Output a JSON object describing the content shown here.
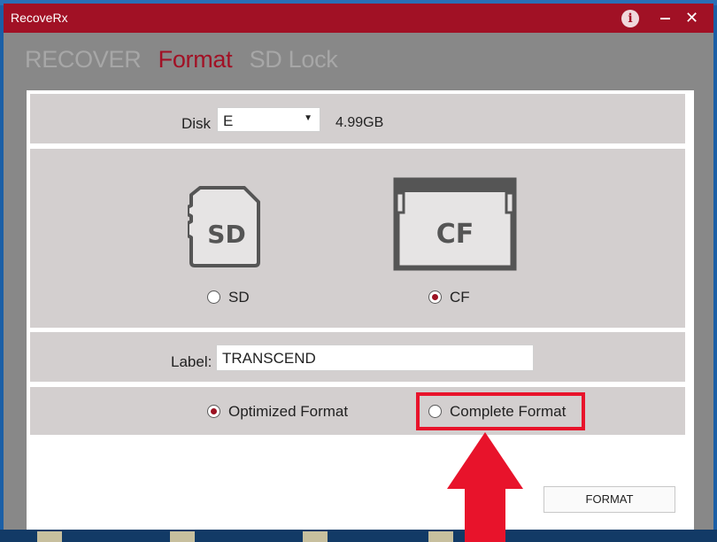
{
  "window": {
    "title": "RecoveRx",
    "info_icon": "info-icon",
    "minimize_icon": "minimize-icon",
    "close_icon": "close-icon",
    "close_glyph": "✕"
  },
  "tabs": [
    {
      "label": "RECOVER",
      "active": false
    },
    {
      "label": "Format",
      "active": true
    },
    {
      "label": "SD Lock",
      "active": false
    }
  ],
  "disk": {
    "label": "Disk",
    "selected": "E",
    "capacity": "4.99GB"
  },
  "card_type": {
    "options": [
      {
        "icon_text": "SD",
        "label": "SD",
        "selected": false
      },
      {
        "icon_text": "CF",
        "label": "CF",
        "selected": true
      }
    ]
  },
  "volume_label": {
    "label": "Label:",
    "value": "TRANSCEND"
  },
  "format_mode": {
    "options": [
      {
        "label": "Optimized Format",
        "selected": true
      },
      {
        "label": "Complete Format",
        "selected": false
      }
    ]
  },
  "format_button": {
    "label": "FORMAT"
  },
  "colors": {
    "accent": "#a11125",
    "highlight": "#e8132b",
    "panel": "#d3cfcf"
  }
}
